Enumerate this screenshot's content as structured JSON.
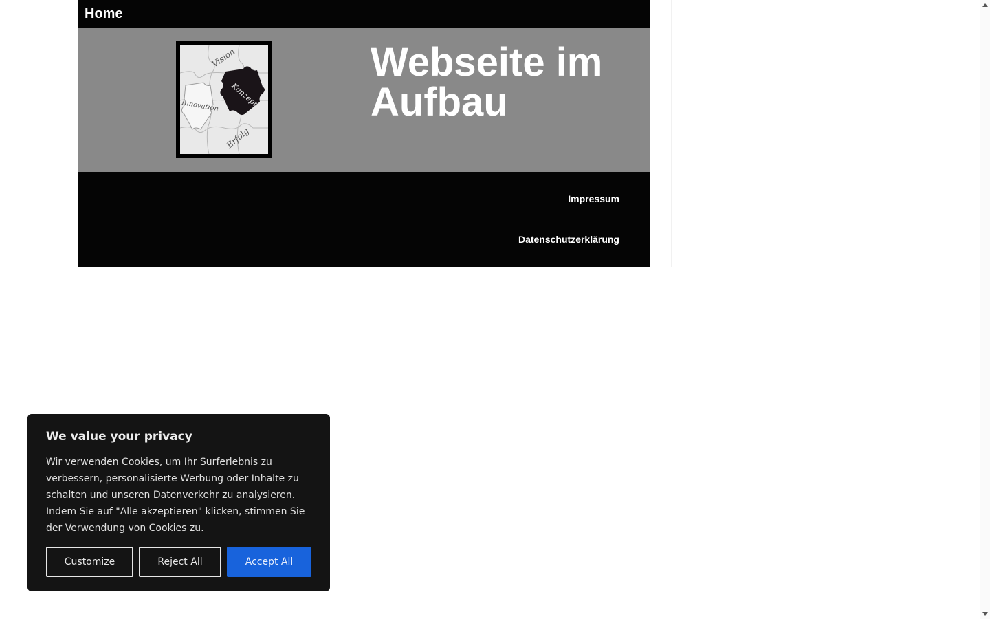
{
  "header": {
    "home_label": "Home"
  },
  "hero": {
    "title": "Webseite im Aufbau",
    "logo_words": [
      "Vision",
      "Konzept",
      "Innovation",
      "Erfolg"
    ]
  },
  "footer": {
    "links": [
      "Impressum",
      "Datenschutzerklärung"
    ]
  },
  "cookie_banner": {
    "title": "We value your privacy",
    "text": "Wir verwenden Cookies, um Ihr Surferlebnis zu verbessern, personalisierte Werbung oder Inhalte zu schalten und unseren Datenverkehr zu analysieren. Indem Sie auf \"Alle akzeptieren\" klicken, stimmen Sie der Verwendung von Cookies zu.",
    "customize_label": "Customize",
    "reject_label": "Reject All",
    "accept_label": "Accept All"
  },
  "colors": {
    "header_bg": "#050505",
    "hero_bg": "#898989",
    "banner_bg": "#141414",
    "accept_bg": "#1863dc"
  }
}
